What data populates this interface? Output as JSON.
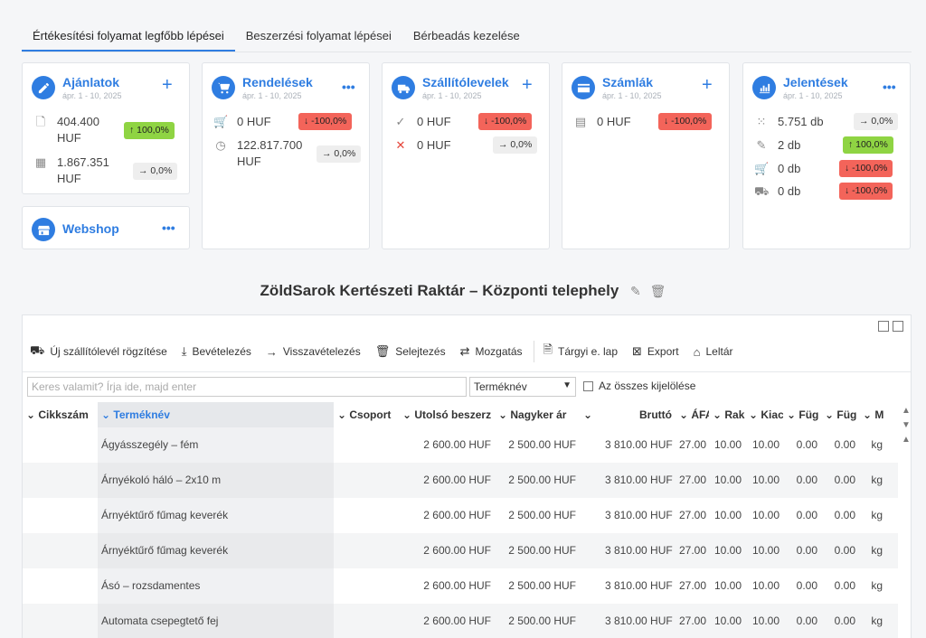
{
  "tabs": [
    {
      "label": "Értékesítési folyamat legfőbb lépései",
      "active": true
    },
    {
      "label": "Beszerzési folyamat lépései",
      "active": false
    },
    {
      "label": "Bérbeadás kezelése",
      "active": false
    }
  ],
  "cards": {
    "ajanlatok": {
      "title": "Ajánlatok",
      "date": "ápr. 1 - 10, 2025",
      "action": "+",
      "rows": [
        {
          "value": "404.400 HUF",
          "badge": "↑ 100,0%",
          "badge_color": "#8fd443"
        },
        {
          "value": "1.867.351 HUF",
          "badge": "→ 0,0%",
          "badge_color": "#eeeeee"
        }
      ]
    },
    "webshop": {
      "title": "Webshop",
      "action": "•••"
    },
    "rendelesek": {
      "title": "Rendelések",
      "date": "ápr. 1 - 10, 2025",
      "action": "•••",
      "rows": [
        {
          "value": "0 HUF",
          "badge": "↓ -100,0%",
          "badge_color": "#f3645a"
        },
        {
          "value": "122.817.700 HUF",
          "badge": "→ 0,0%",
          "badge_color": "#eeeeee"
        }
      ]
    },
    "szallitolevelek": {
      "title": "Szállítólevelek",
      "date": "ápr. 1 - 10, 2025",
      "action": "+",
      "rows": [
        {
          "value": "0 HUF",
          "badge": "↓ -100,0%",
          "badge_color": "#f3645a"
        },
        {
          "value": "0 HUF",
          "badge": "→ 0,0%",
          "badge_color": "#eeeeee"
        }
      ]
    },
    "szamlak": {
      "title": "Számlák",
      "date": "ápr. 1 - 10, 2025",
      "action": "+",
      "rows": [
        {
          "value": "0 HUF",
          "badge": "↓ -100,0%",
          "badge_color": "#f3645a"
        }
      ]
    },
    "jelentesek": {
      "title": "Jelentések",
      "date": "ápr. 1 - 10, 2025",
      "action": "•••",
      "rows": [
        {
          "value": "5.751 db",
          "badge": "→ 0,0%",
          "badge_color": "#eeeeee"
        },
        {
          "value": "2 db",
          "badge": "↑ 100,0%",
          "badge_color": "#8fd443"
        },
        {
          "value": "0 db",
          "badge": "↓ -100,0%",
          "badge_color": "#f3645a"
        },
        {
          "value": "0 db",
          "badge": "↓ -100,0%",
          "badge_color": "#f3645a"
        }
      ]
    }
  },
  "warehouse_title": "ZöldSarok Kertészeti Raktár – Központi telephely",
  "toolbar": [
    {
      "label": "Új szállítólevél rögzítése",
      "icon": "truck-icon"
    },
    {
      "label": "Bevételezés",
      "icon": "inbox-icon"
    },
    {
      "label": "Visszavételezés",
      "icon": "arrow-right-icon"
    },
    {
      "label": "Selejtezés",
      "icon": "trash-icon"
    },
    {
      "label": "Mozgatás",
      "icon": "swap-icon"
    },
    {
      "label": "Tárgyi e. lap",
      "icon": "document-icon"
    },
    {
      "label": "Export",
      "icon": "excel-icon"
    },
    {
      "label": "Leltár",
      "icon": "home-icon"
    }
  ],
  "search": {
    "placeholder": "Keres valamit? Írja ide, majd enter",
    "field_select": "Terméknév",
    "select_all_label": "Az összes kijelölése"
  },
  "columns": [
    "Cikkszám",
    "Terméknév",
    "Csoport",
    "Utolsó beszerz",
    "Nagyker ár",
    "",
    "Bruttó",
    "ÁFA",
    "Rak",
    "Kiac",
    "Füg",
    "Füg",
    "M"
  ],
  "rows": [
    {
      "sku": "",
      "name": "Ágyásszegély – fém",
      "group": "",
      "last_price": "2 600.00 HUF",
      "wholesale": "2 500.00 HUF",
      "gross": "3 810.00 HUF",
      "vat": "27.00",
      "stock": "10.00",
      "out": "10.00",
      "f1": "0.00",
      "f2": "0.00",
      "unit": "kg"
    },
    {
      "sku": "",
      "name": "Árnyékoló háló – 2x10 m",
      "group": "",
      "last_price": "2 600.00 HUF",
      "wholesale": "2 500.00 HUF",
      "gross": "3 810.00 HUF",
      "vat": "27.00",
      "stock": "10.00",
      "out": "10.00",
      "f1": "0.00",
      "f2": "0.00",
      "unit": "kg"
    },
    {
      "sku": "",
      "name": "Árnyéktűrő fűmag keverék",
      "group": "",
      "last_price": "2 600.00 HUF",
      "wholesale": "2 500.00 HUF",
      "gross": "3 810.00 HUF",
      "vat": "27.00",
      "stock": "10.00",
      "out": "10.00",
      "f1": "0.00",
      "f2": "0.00",
      "unit": "kg"
    },
    {
      "sku": "",
      "name": "Árnyéktűrő fűmag keverék",
      "group": "",
      "last_price": "2 600.00 HUF",
      "wholesale": "2 500.00 HUF",
      "gross": "3 810.00 HUF",
      "vat": "27.00",
      "stock": "10.00",
      "out": "10.00",
      "f1": "0.00",
      "f2": "0.00",
      "unit": "kg"
    },
    {
      "sku": "",
      "name": "Ásó – rozsdamentes",
      "group": "",
      "last_price": "2 600.00 HUF",
      "wholesale": "2 500.00 HUF",
      "gross": "3 810.00 HUF",
      "vat": "27.00",
      "stock": "10.00",
      "out": "10.00",
      "f1": "0.00",
      "f2": "0.00",
      "unit": "kg"
    },
    {
      "sku": "",
      "name": "Automata csepegtető fej",
      "group": "",
      "last_price": "2 600.00 HUF",
      "wholesale": "2 500.00 HUF",
      "gross": "3 810.00 HUF",
      "vat": "27.00",
      "stock": "10.00",
      "out": "10.00",
      "f1": "0.00",
      "f2": "0.00",
      "unit": "kg"
    }
  ]
}
